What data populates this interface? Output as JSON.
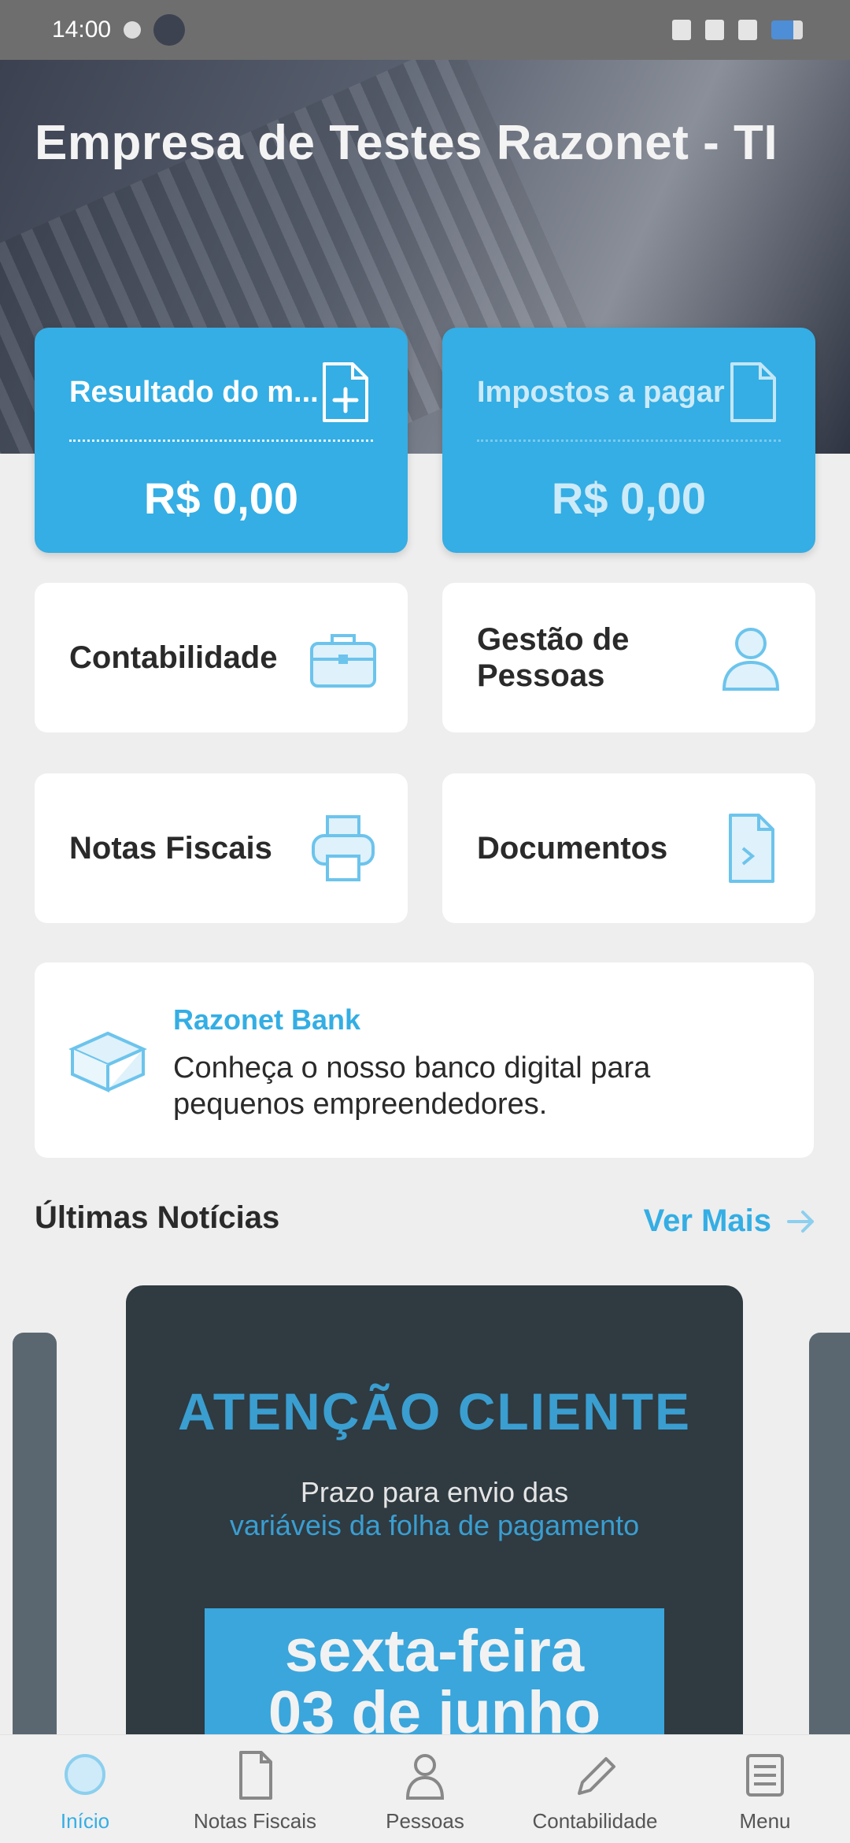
{
  "status_bar": {
    "time": "14:00"
  },
  "hero": {
    "company": "Empresa de Testes Razonet - TI"
  },
  "summary_cards": [
    {
      "label": "Resultado do m...",
      "value": "R$ 0,00",
      "icon": "file-plus-icon"
    },
    {
      "label": "Impostos a pagar",
      "value": "R$ 0,00",
      "icon": "file-icon"
    }
  ],
  "tiles": [
    {
      "label": "Contabilidade",
      "icon": "briefcase-icon"
    },
    {
      "label": "Gestão de Pessoas",
      "icon": "person-icon"
    },
    {
      "label": "Notas Fiscais",
      "icon": "printer-icon"
    },
    {
      "label": "Documentos",
      "icon": "document-icon"
    }
  ],
  "promo": {
    "title": "Razonet Bank",
    "description": "Conheça o nosso banco digital para pequenos empreendedores.",
    "icon": "box-icon"
  },
  "news": {
    "heading": "Últimas Notícias",
    "see_more": "Ver Mais",
    "featured": {
      "title": "ATENÇÃO CLIENTE",
      "line1": "Prazo para envio das",
      "line2": "variáveis da folha de pagamento",
      "date_line1": "sexta-feira",
      "date_line2": "03 de junho"
    }
  },
  "bottom_nav": [
    {
      "label": "Início",
      "icon": "home-icon",
      "active": true
    },
    {
      "label": "Notas Fiscais",
      "icon": "invoice-icon",
      "active": false
    },
    {
      "label": "Pessoas",
      "icon": "people-icon",
      "active": false
    },
    {
      "label": "Contabilidade",
      "icon": "pencil-icon",
      "active": false
    },
    {
      "label": "Menu",
      "icon": "menu-icon",
      "active": false
    }
  ],
  "colors": {
    "accent": "#34aee4",
    "news_bg": "#2f3a41",
    "background": "#eeeeee"
  }
}
